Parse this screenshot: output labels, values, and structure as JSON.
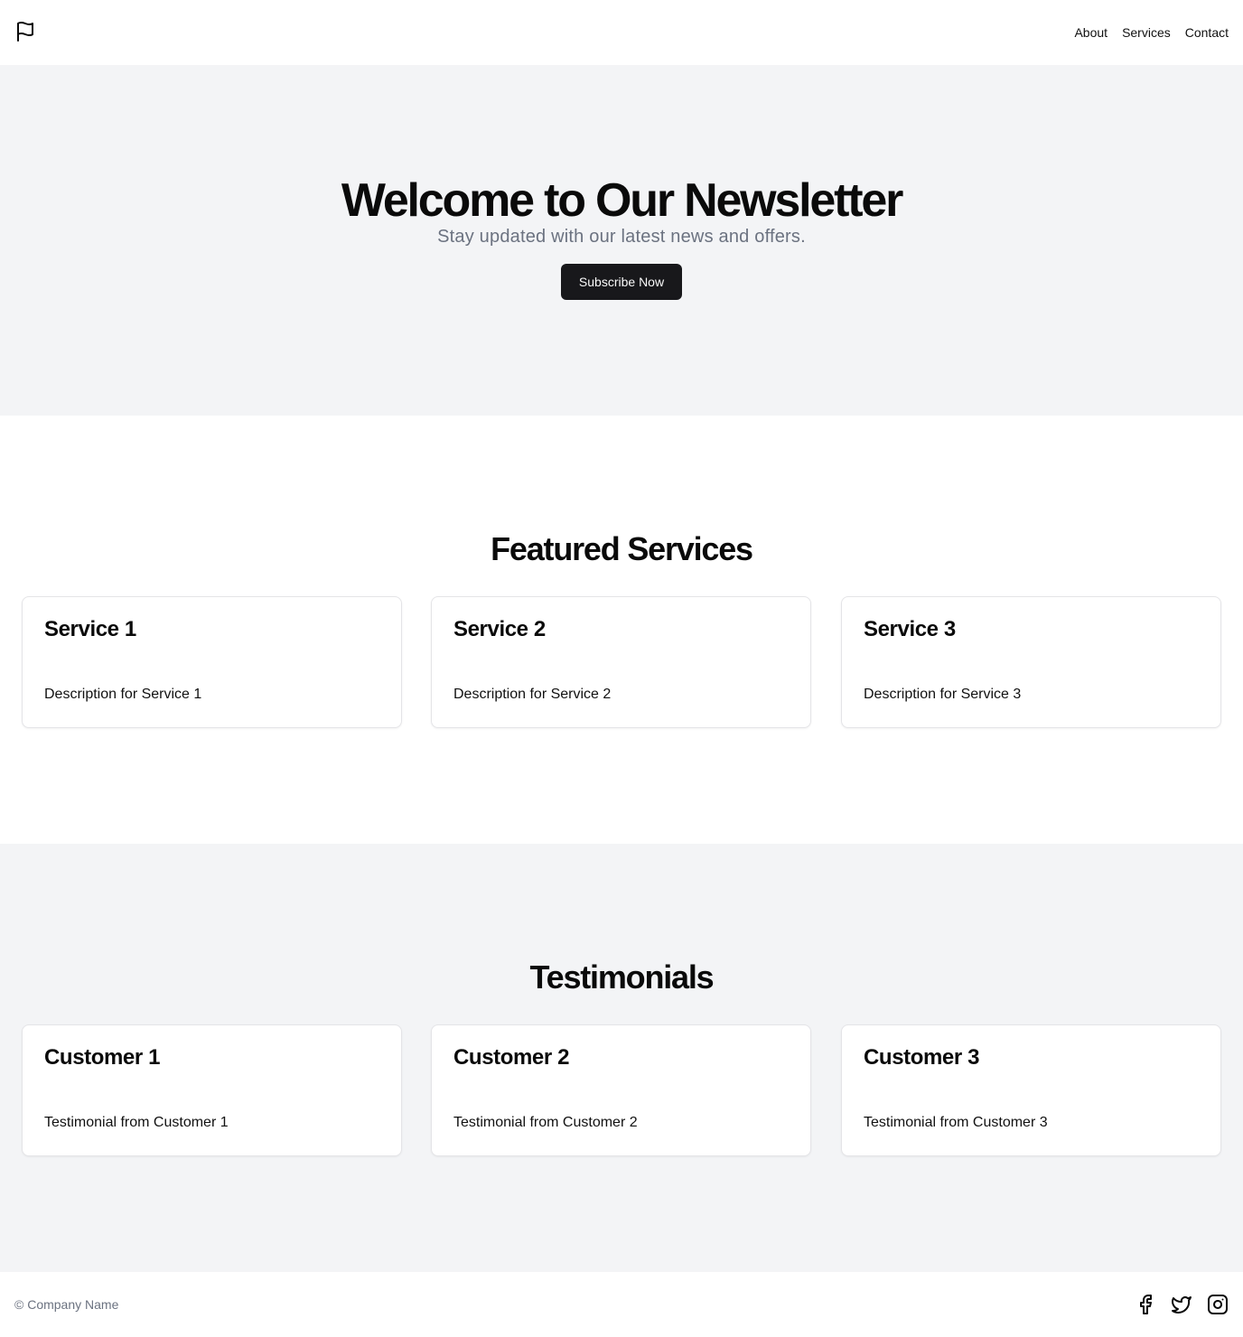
{
  "header": {
    "logo_icon": "flag-icon",
    "nav": [
      {
        "label": "About"
      },
      {
        "label": "Services"
      },
      {
        "label": "Contact"
      }
    ]
  },
  "hero": {
    "title": "Welcome to Our Newsletter",
    "subtitle": "Stay updated with our latest news and offers.",
    "cta_label": "Subscribe Now"
  },
  "services": {
    "heading": "Featured Services",
    "cards": [
      {
        "title": "Service 1",
        "description": "Description for Service 1"
      },
      {
        "title": "Service 2",
        "description": "Description for Service 2"
      },
      {
        "title": "Service 3",
        "description": "Description for Service 3"
      }
    ]
  },
  "testimonials": {
    "heading": "Testimonials",
    "cards": [
      {
        "title": "Customer 1",
        "text": "Testimonial from Customer 1"
      },
      {
        "title": "Customer 2",
        "text": "Testimonial from Customer 2"
      },
      {
        "title": "Customer 3",
        "text": "Testimonial from Customer 3"
      }
    ]
  },
  "footer": {
    "copyright": "© Company Name",
    "social_icons": [
      "facebook-icon",
      "twitter-icon",
      "instagram-icon"
    ]
  },
  "colors": {
    "section_alt_bg": "#f3f4f6",
    "button_bg": "#18181b",
    "muted_text": "#6b7280"
  }
}
